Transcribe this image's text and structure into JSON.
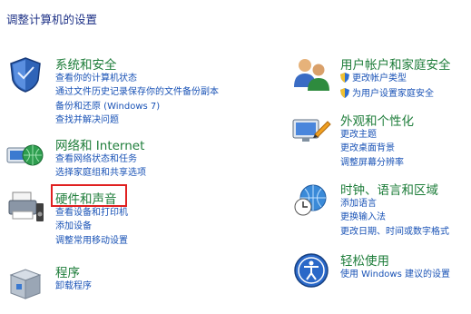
{
  "page_title": "调整计算机的设置",
  "left": [
    {
      "title": "系统和安全",
      "links": [
        "查看你的计算机状态",
        "通过文件历史记录保存你的文件备份副本",
        "备份和还原 (Windows 7)",
        "查找并解决问题"
      ]
    },
    {
      "title": "网络和 Internet",
      "links": [
        "查看网络状态和任务",
        "选择家庭组和共享选项"
      ]
    },
    {
      "title": "硬件和声音",
      "links": [
        "查看设备和打印机",
        "添加设备",
        "调整常用移动设置"
      ]
    },
    {
      "title": "程序",
      "links": [
        "卸载程序"
      ]
    }
  ],
  "right": [
    {
      "title": "用户帐户和家庭安全",
      "links": [
        "更改帐户类型",
        "为用户设置家庭安全"
      ]
    },
    {
      "title": "外观和个性化",
      "links": [
        "更改主题",
        "更改桌面背景",
        "调整屏幕分辨率"
      ]
    },
    {
      "title": "时钟、语言和区域",
      "links": [
        "添加语言",
        "更换输入法",
        "更改日期、时间或数字格式"
      ]
    },
    {
      "title": "轻松使用",
      "links": [
        "使用 Windows 建议的设置"
      ]
    }
  ],
  "highlight_color": "#e02020",
  "title_color": "#1e7d3a",
  "link_color": "#1a53b6"
}
